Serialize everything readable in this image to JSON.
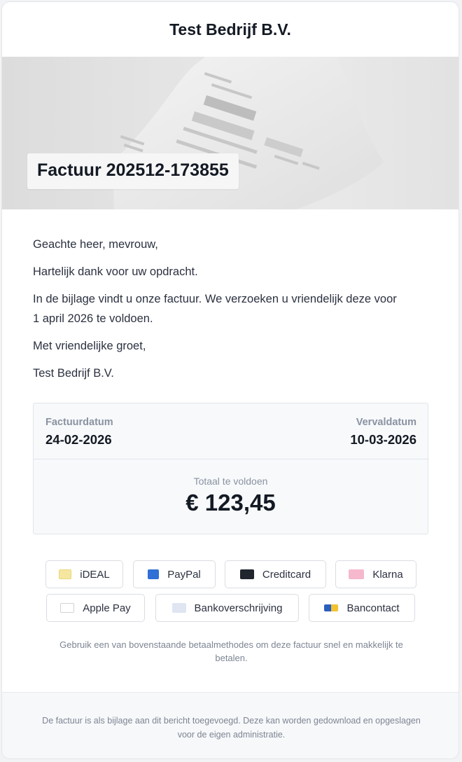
{
  "header": {
    "company": "Test Bedrijf B.V."
  },
  "hero": {
    "title": "Factuur 202512-173855"
  },
  "message": {
    "greeting": "Geachte heer, mevrouw,",
    "thanks": "Hartelijk dank voor uw opdracht.",
    "body_line1": "In de bijlage vindt u onze factuur. We verzoeken u vriendelijk deze voor",
    "body_line2": "1 april 2026 te voldoen.",
    "closing": "Met vriendelijke groet,",
    "signature": "Test Bedrijf B.V."
  },
  "invoice": {
    "invoice_date_label": "Factuurdatum",
    "invoice_date": "24-02-2026",
    "due_date_label": "Vervaldatum",
    "due_date": "10-03-2026",
    "total_label": "Totaal te voldoen",
    "total": "€ 123,45"
  },
  "payment": {
    "methods": [
      {
        "label": "iDEAL",
        "icon": "ideal-icon",
        "color": "#f5e7a0"
      },
      {
        "label": "PayPal",
        "icon": "paypal-icon",
        "color": "#2f6fd6"
      },
      {
        "label": "Creditcard",
        "icon": "creditcard-icon",
        "color": "#20252e"
      },
      {
        "label": "Klarna",
        "icon": "klarna-icon",
        "color": "#f5b8cc"
      },
      {
        "label": "Apple Pay",
        "icon": "apple-pay-icon",
        "color": "#1a1a1a"
      },
      {
        "label": "Bankoverschrijving",
        "icon": "bank-transfer-icon",
        "color": "#dfe6f2"
      },
      {
        "label": "Bancontact",
        "icon": "bancontact-icon",
        "color": "#f2c230"
      }
    ],
    "note": "Gebruik een van bovenstaande betaalmethodes om deze factuur snel en makkelijk te betalen."
  },
  "footer": {
    "text": "De factuur is als bijlage aan dit bericht toegevoegd. Deze kan worden gedownload en opgeslagen voor de eigen administratie."
  }
}
